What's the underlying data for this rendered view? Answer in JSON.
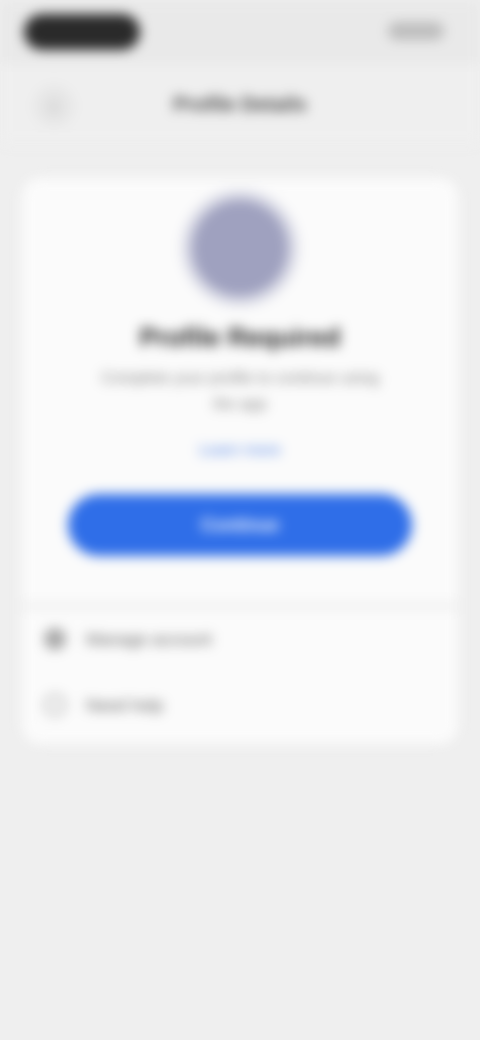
{
  "header": {
    "title": "Profile Details",
    "back_glyph": "‹"
  },
  "card": {
    "title": "Profile Required",
    "description": "Complete your profile to continue using the app",
    "link": "Learn more",
    "primary_button": "Continue"
  },
  "options": [
    {
      "label": "Manage account",
      "icon": "account-icon"
    },
    {
      "label": "Need help",
      "icon": "help-icon"
    }
  ],
  "colors": {
    "accent": "#2f6ee8",
    "link": "#4a7fe6",
    "avatar": "#9fa1bf",
    "background": "#efefef",
    "card": "#fbfbfb"
  }
}
